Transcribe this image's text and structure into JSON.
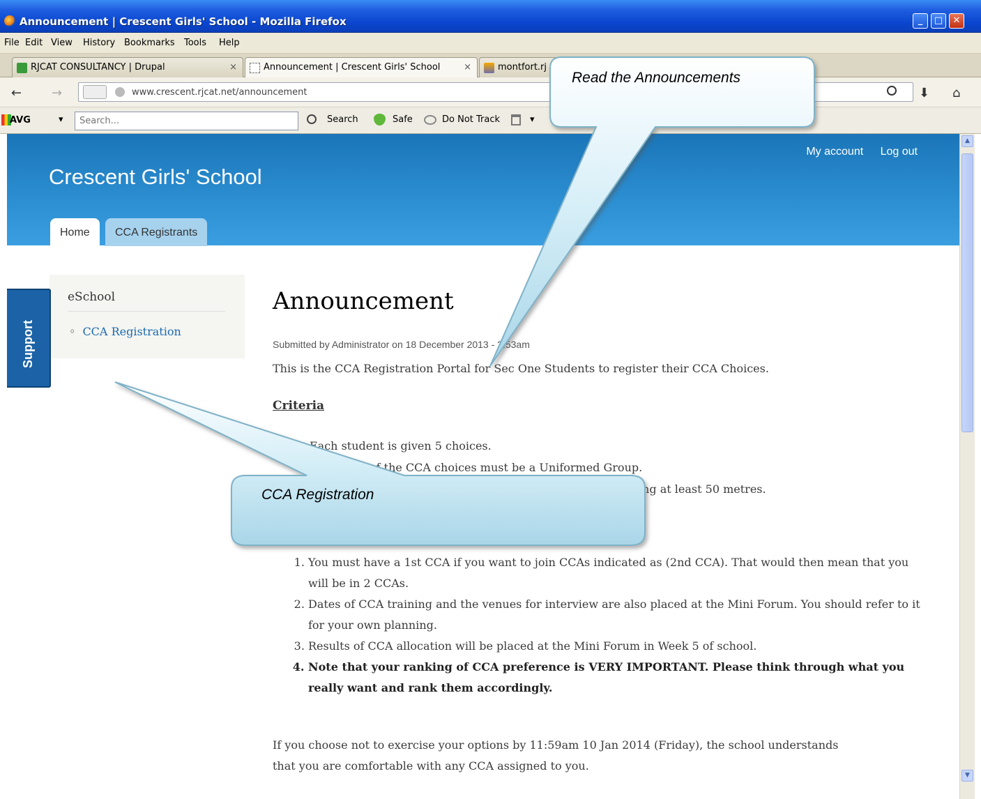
{
  "window": {
    "title": "Announcement | Crescent Girls' School - Mozilla Firefox",
    "controls": [
      "_",
      "□",
      "✕"
    ]
  },
  "menu": [
    "File",
    "Edit",
    "View",
    "History",
    "Bookmarks",
    "Tools",
    "Help"
  ],
  "tabs": [
    {
      "label": "RJCAT CONSULTANCY | Drupal",
      "icon": "rjcat-favicon"
    },
    {
      "label": "Announcement | Crescent Girls' School",
      "icon": "blank-page-icon",
      "active": true
    },
    {
      "label": "montfort.rj",
      "icon": "phpmyadmin-favicon"
    }
  ],
  "tab_close": "×",
  "navbar": {
    "url": "www.crescent.rjcat.net/announcement",
    "back": "←",
    "forward": "→",
    "download": "⬇",
    "home": "⌂"
  },
  "avg": {
    "logo": "AVG",
    "search_placeholder": "Search...",
    "search_button": "Search",
    "safe": "Safe",
    "do_not_track": "Do Not Track"
  },
  "site": {
    "name": "Crescent Girls' School",
    "secondary_menu": [
      "My account",
      "Log out"
    ],
    "main_tabs": [
      "Home",
      "CCA Registrants"
    ],
    "support_label": "Support"
  },
  "sidebar": {
    "title": "eSchool",
    "items": [
      "CCA Registration"
    ]
  },
  "article": {
    "title": "Announcement",
    "submitted": "Submitted by Administrator on 18 December 2013 - 2:53am",
    "intro": "This is the CCA Registration Portal for Sec One Students to register their CCA Choices.",
    "criteria_heading": "Criteria",
    "criteria": [
      "Each student is given 5 choices.",
      "of the CCA choices must be a Uniformed Group.",
      "ing at least 50 metres."
    ],
    "notes": [
      "You must have a 1st CCA if you want to join CCAs indicated as (2nd CCA). That would then mean that you will be in 2 CCAs.",
      "Dates of CCA training and the venues for interview are also placed at the Mini Forum. You should refer to it for your own planning.",
      "Results of CCA allocation will be placed at the Mini Forum in Week 5 of school.",
      "Note that your ranking of CCA preference is VERY IMPORTANT. Please think through what you really want and rank them accordingly."
    ],
    "closing_line_1": "If you choose not to exercise your options by 11:59am 10 Jan 2014 (Friday), the school understands",
    "closing_line_2": "that you are comfortable with any CCA assigned to you."
  },
  "callouts": {
    "top": "Read the Announcements",
    "bottom": "CCA Registration"
  },
  "colors": {
    "header_blue": "#2c8fd1",
    "link_blue": "#1a6bb0",
    "callout_fill": "#bfe3f0",
    "callout_stroke": "#7fb2c8"
  }
}
